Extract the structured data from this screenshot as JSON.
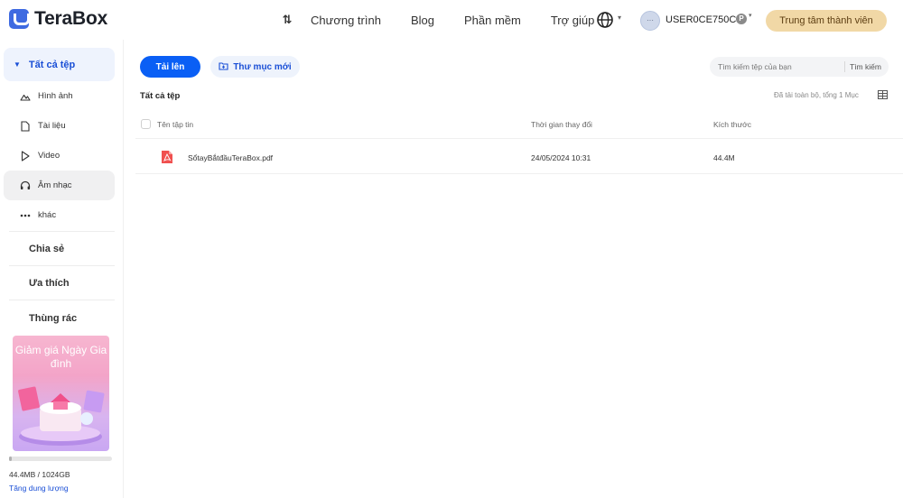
{
  "header": {
    "logo_text": "TeraBox",
    "nav": [
      "Chương trình",
      "Blog",
      "Phần mềm",
      "Trợ giúp"
    ],
    "avatar_text": "···",
    "username": "USER0CE750C4",
    "badge": "P",
    "member_button": "Trung tâm thành viên"
  },
  "sidebar": {
    "all_files": "Tất cả tệp",
    "categories": [
      {
        "label": "Hình ảnh",
        "icon": "image-icon"
      },
      {
        "label": "Tài liệu",
        "icon": "document-icon"
      },
      {
        "label": "Video",
        "icon": "play-icon"
      },
      {
        "label": "Âm nhạc",
        "icon": "headphones-icon"
      },
      {
        "label": "khác",
        "icon": "more-icon"
      }
    ],
    "share": "Chia sẻ",
    "favorites": "Ưa thích",
    "trash": "Thùng rác",
    "promo_text": "Giảm giá Ngày Gia đình",
    "storage_text": "44.4MB / 1024GB",
    "storage_fraction": 4.23e-05,
    "storage_link": "Tăng dung lượng"
  },
  "toolbar": {
    "upload": "Tải lên",
    "new_folder": "Thư mục mới",
    "search_placeholder": "Tìm kiếm tệp của bạn",
    "search_button": "Tìm kiếm"
  },
  "content": {
    "breadcrumb": "Tất cả tệp",
    "loaded_text": "Đã tải toàn bộ, tổng 1 Mục",
    "columns": {
      "name": "Tên tập tin",
      "modified": "Thời gian thay đổi",
      "size": "Kích thước"
    },
    "files": [
      {
        "name": "SổtayBắtđầuTeraBox.pdf",
        "modified": "24/05/2024 10:31",
        "size": "44.4M",
        "type": "pdf"
      }
    ]
  },
  "colors": {
    "accent": "#0a5ff5",
    "member": "#f1d8a6",
    "pdf": "#f0504f"
  }
}
